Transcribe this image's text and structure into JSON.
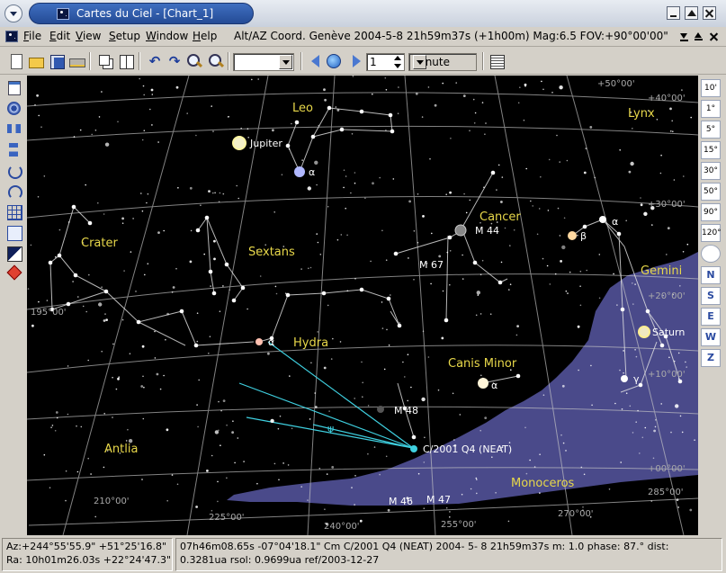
{
  "window": {
    "title": "Cartes du Ciel - [Chart_1]"
  },
  "menu": {
    "items": [
      "File",
      "Edit",
      "View",
      "Setup",
      "Window",
      "Help"
    ],
    "chart_info": "Alt/AZ Coord. Genève 2004-5-8 21h59m37s (+1h00m) Mag:6.5 FOV:+90°00'00\""
  },
  "toolbar": {
    "step_value": "1",
    "step_unit": "Minute",
    "icons": [
      "new-chart-icon",
      "open-icon",
      "save-icon",
      "print-icon",
      "cascade-icon",
      "tile-icon",
      "undo-icon",
      "redo-icon",
      "zoom-in-icon",
      "zoom-out-icon",
      "previous-icon",
      "reset-time-icon",
      "next-icon",
      "object-list-icon"
    ]
  },
  "left_toolbar": {
    "icons": [
      "chart-settings-icon",
      "projection-icon",
      "flip-horizontal-icon",
      "flip-vertical-icon",
      "rotate-right-icon",
      "rotate-left-icon",
      "grid-icon",
      "label-icon",
      "night-vision-icon",
      "marker-icon"
    ]
  },
  "right_toolbar": {
    "fov": [
      "10'",
      "1°",
      "5°",
      "15°",
      "30°",
      "50°",
      "90°",
      "120°"
    ],
    "directions": [
      "N",
      "S",
      "E",
      "W",
      "Z"
    ]
  },
  "chart": {
    "colors": {
      "sky": "#000000",
      "grid": "#c8c8c8",
      "constellation_name": "#e8d84a",
      "milky_way": "#4a4a8a",
      "comet": "#3fd0e0",
      "label": "#ffffff"
    },
    "constellations": [
      "Leo",
      "Lynx",
      "Crater",
      "Sextans",
      "Cancer",
      "Gemini",
      "Hydra",
      "Canis Minor",
      "Antlia",
      "Monoceros"
    ],
    "labels": {
      "jupiter": "Jupiter",
      "saturn": "Saturn",
      "m44": "M 44",
      "m67": "M 67",
      "m48": "M 48",
      "m46": "M 46",
      "m47": "M 47",
      "comet": "C/2001 Q4 (NEAT)",
      "alpha_leo": "α",
      "alpha_hya": "α",
      "alpha_cmi": "α",
      "alpha_gem": "α",
      "beta_gem": "β",
      "gamma_gem": "γ",
      "comet_tail": "ψ"
    },
    "alt_grid_labels": [
      "+50°00'",
      "+40°00'",
      "+30°00'",
      "+20°00'",
      "+10°00'",
      "+00°00'"
    ],
    "az_grid_labels": [
      "195°00'",
      "210°00'",
      "225°00'",
      "240°00'",
      "255°00'",
      "270°00'",
      "285°00'"
    ]
  },
  "statusbar": {
    "azalt": "Az:+244°55'55.9\" +51°25'16.8\"",
    "radec": "Ra: 10h01m26.03s +22°24'47.3\"",
    "object_line1": "07h46m08.65s -07°04'18.1\"  Cm C/2001 Q4 (NEAT) 2004- 5- 8 21h59m37s m:  1.0 phase:  87.° dist:",
    "object_line2": "0.3281ua rsol: 0.9699ua ref/2003-12-27"
  }
}
